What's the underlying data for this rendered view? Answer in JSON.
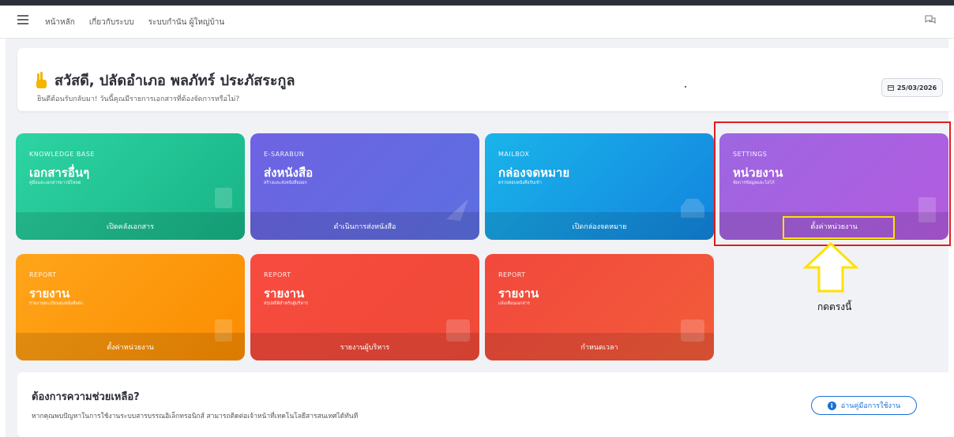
{
  "nav": {
    "links": [
      "หน้าหลัก",
      "เกี่ยวกับระบบ",
      "ระบบกำนัน ผู้ใหญ่บ้าน"
    ]
  },
  "welcome": {
    "title": "สวัสดี, ปลัดอำเภอ พลภัทร์ ประภัสระกูล",
    "subtitle": "ยินดีต้อนรับกลับมา! วันนี้คุณมีรายการเอกสารที่ต้องจัดการหรือไม่?",
    "date": "25/03/2026"
  },
  "cards": [
    {
      "category": "KNOWLEDGE BASE",
      "name": "เอกสารอื่นๆ",
      "desc": "คู่มือและเอกสารดาวน์โหลด",
      "action": "เปิดคลังเอกสาร"
    },
    {
      "category": "E-SARABUN",
      "name": "ส่งหนังสือ",
      "desc": "สร้างและส่งหนังสือออก",
      "action": "ดำเนินการส่งหนังสือ"
    },
    {
      "category": "MAILBOX",
      "name": "กล่องจดหมาย",
      "desc": "ตรวจสอบหนังสือรับเข้า",
      "action": "เปิดกล่องจดหมาย"
    },
    {
      "category": "SETTINGS",
      "name": "หน่วยงาน",
      "desc": "จัดการข้อมูลและโลโก้",
      "action": "ตั้งค่าหน่วยงาน"
    },
    {
      "category": "REPORT",
      "name": "รายงาน",
      "desc": "รายงานทะเบียนคุมหนังสือส่ง",
      "action": "ตั้งค่าหน่วยงาน"
    },
    {
      "category": "REPORT",
      "name": "รายงาน",
      "desc": "สรุปสถิติสำหรับผู้บริหาร",
      "action": "รายงานผู้บริหาร"
    },
    {
      "category": "REPORT",
      "name": "รายงาน",
      "desc": "แจ้งเตือนเอกสาร",
      "action": "กำหนดเวลา"
    }
  ],
  "annotation": {
    "label": "กดตรงนี้"
  },
  "help": {
    "title": "ต้องการความช่วยเหลือ?",
    "desc": "หากคุณพบปัญหาในการใช้งานระบบสารบรรณอิเล็กทรอนิกส์ สามารถติดต่อเจ้าหน้าที่เทคโนโลยีสารสนเทศได้ทันที",
    "button": "อ่านคู่มือการใช้งาน"
  },
  "colors": {
    "highlight_red": "#e01e1e",
    "highlight_yellow": "#ffe100",
    "primary_blue": "#1971d6"
  }
}
